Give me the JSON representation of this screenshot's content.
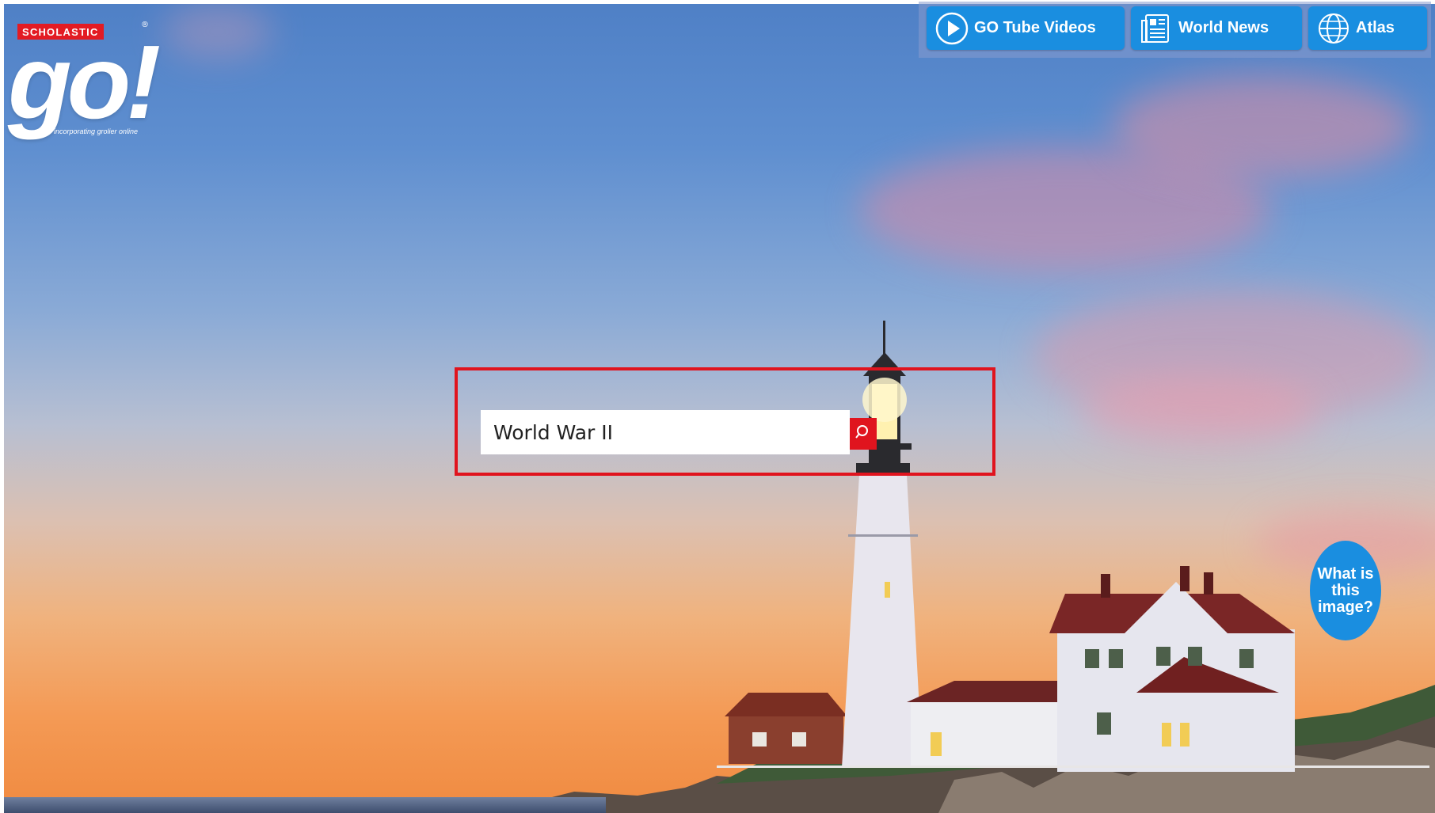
{
  "logo": {
    "badge": "SCHOLASTIC",
    "wordmark": "go!",
    "tagline": "incorporating grolier online",
    "registered": "®"
  },
  "nav": {
    "items": [
      {
        "label": "GO Tube Videos",
        "icon": "play-icon"
      },
      {
        "label": "World News",
        "icon": "newspaper-icon"
      },
      {
        "label": "Atlas",
        "icon": "globe-icon"
      }
    ]
  },
  "search": {
    "value": "World War II",
    "button_icon": "search-icon"
  },
  "info_button": {
    "label": "What is this image?"
  },
  "colors": {
    "accent_blue": "#1a8ee0",
    "search_red": "#e0141e",
    "highlight_red": "#e0141e"
  }
}
